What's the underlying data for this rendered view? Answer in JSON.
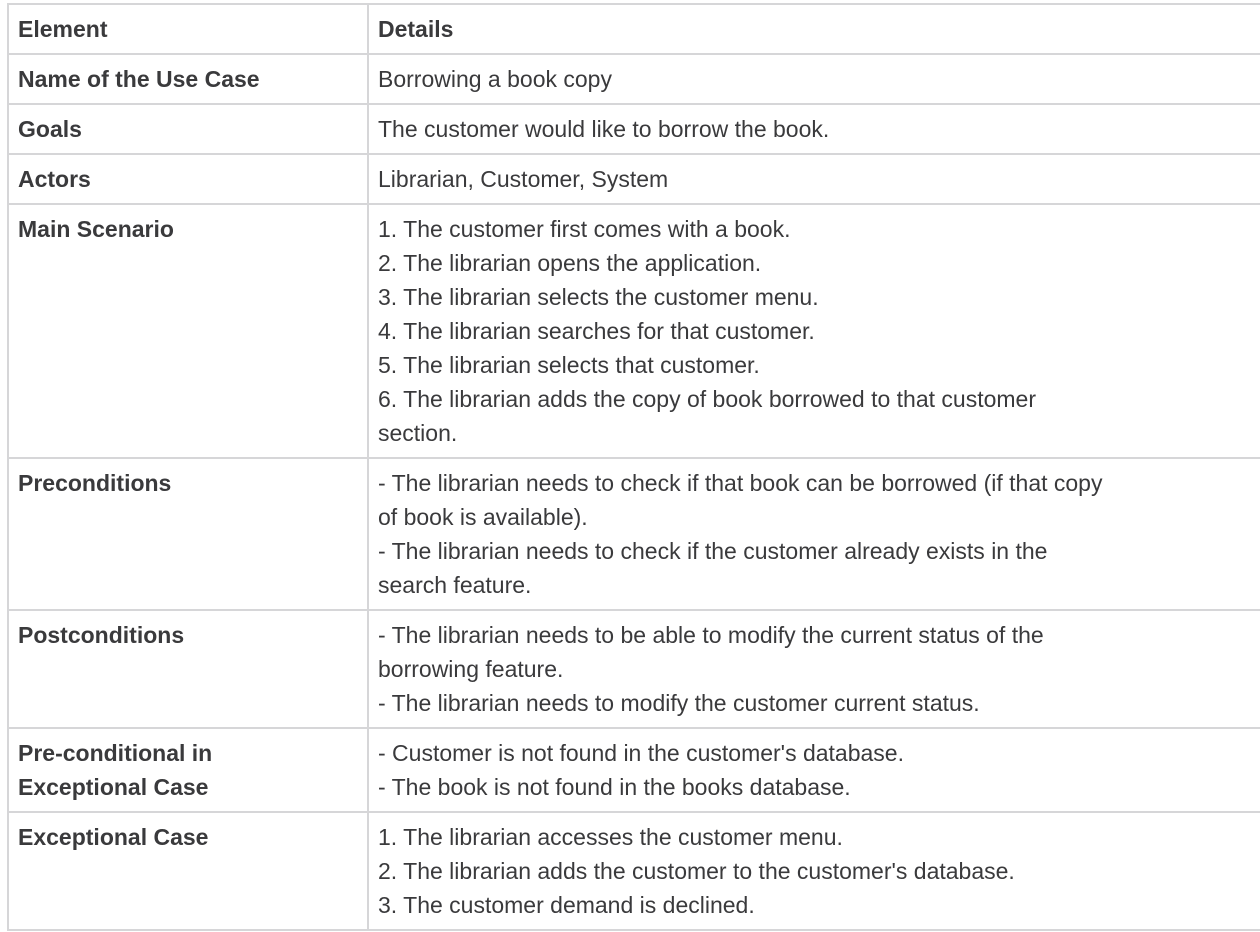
{
  "table": {
    "headers": [
      "Element",
      "Details"
    ],
    "rows": [
      {
        "label": [
          "Name of the Use Case"
        ],
        "details": [
          "Borrowing a book copy"
        ]
      },
      {
        "label": [
          "Goals"
        ],
        "details": [
          "The customer would like to borrow the book."
        ]
      },
      {
        "label": [
          "Actors"
        ],
        "details": [
          "Librarian, Customer, System"
        ]
      },
      {
        "label": [
          "Main Scenario"
        ],
        "details": [
          "1. The customer first comes with a book.",
          "2. The librarian opens the application.",
          "3. The librarian selects the customer menu.",
          "4. The librarian searches for that customer.",
          "5. The librarian selects that customer.",
          "6. The librarian adds the copy of book borrowed to that customer",
          "section."
        ]
      },
      {
        "label": [
          "Preconditions"
        ],
        "details": [
          "- The librarian needs to check if that book can be borrowed (if that copy",
          "of book is available).",
          "- The librarian needs to check if the customer already exists in the",
          "search feature."
        ]
      },
      {
        "label": [
          "Postconditions"
        ],
        "details": [
          "- The librarian needs to be able to modify the current status of the",
          "borrowing feature.",
          "- The librarian needs to modify the customer current status."
        ]
      },
      {
        "label": [
          "Pre-conditional in",
          "Exceptional Case"
        ],
        "details": [
          "- Customer is not found in the customer's database.",
          "- The book is not found in the books database."
        ]
      },
      {
        "label": [
          "Exceptional Case"
        ],
        "details": [
          "1. The librarian accesses the customer menu.",
          "2. The librarian adds the customer to the customer's database.",
          "3. The customer demand is declined."
        ]
      }
    ]
  }
}
